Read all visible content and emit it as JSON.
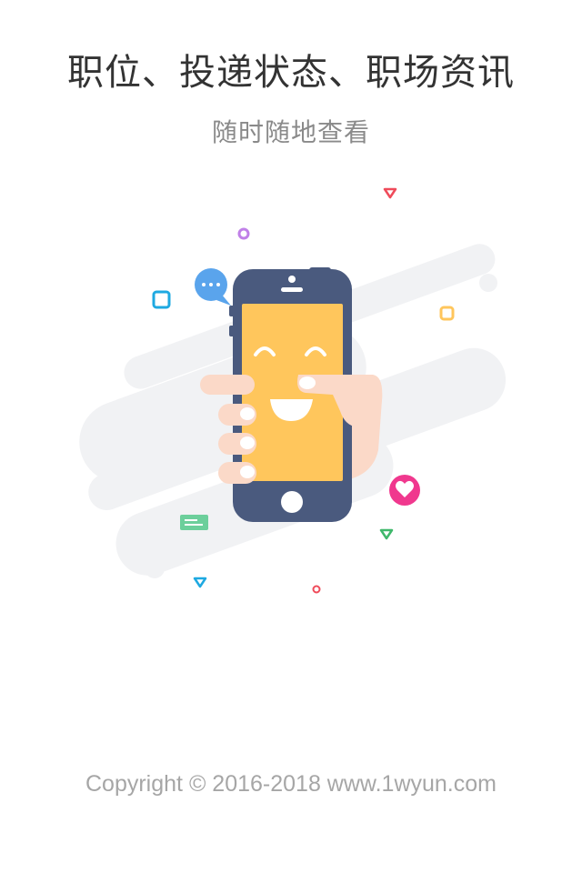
{
  "splash": {
    "headline": "职位、投递状态、职场资讯",
    "subheadline": "随时随地查看",
    "copyright": "Copyright © 2016-2018 www.1wyun.com"
  },
  "illustration": {
    "icons": [
      "phone-icon",
      "smiley-face-icon",
      "hand-icon",
      "chat-bubble-icon",
      "heart-icon",
      "message-card-icon"
    ],
    "colors": {
      "phone_body": "#4a5a7e",
      "screen": "#ffc65c",
      "skin": "#fbd9c8",
      "chat_bubble": "#5aa4ec",
      "heart_badge": "#f0388e",
      "card": "#6ccf9b",
      "cloud": "#f1f2f4"
    }
  }
}
